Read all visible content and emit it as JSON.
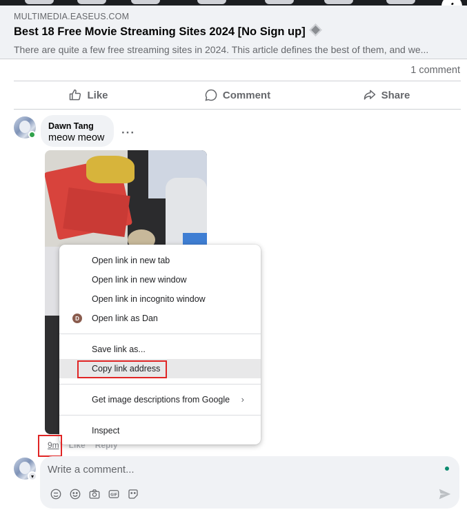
{
  "link_preview": {
    "domain": "MULTIMEDIA.EASEUS.COM",
    "title": "Best 18 Free Movie Streaming Sites 2024 [No Sign up]",
    "description": "There are quite a few free streaming sites in 2024. This article defines the best of them, and we..."
  },
  "post_stats": {
    "comment_count": "1 comment"
  },
  "actions": {
    "like": "Like",
    "comment": "Comment",
    "share": "Share"
  },
  "comment": {
    "author": "Dawn Tang",
    "text": "meow meow",
    "more_options": "···",
    "time": "9m",
    "like_label": "Like",
    "reply_label": "Reply"
  },
  "context_menu": {
    "items": [
      {
        "label": "Open link in new tab"
      },
      {
        "label": "Open link in new window"
      },
      {
        "label": "Open link in incognito window"
      },
      {
        "label": "Open link as Dan",
        "profile_initial": "D"
      }
    ],
    "items2": [
      {
        "label": "Save link as..."
      },
      {
        "label": "Copy link address"
      }
    ],
    "items3": [
      {
        "label": "Get image descriptions from Google",
        "arrow": "›"
      }
    ],
    "items4": [
      {
        "label": "Inspect"
      }
    ]
  },
  "composer": {
    "placeholder": "Write a comment..."
  },
  "colors": {
    "highlight_box": "#e02424",
    "online": "#31a24c",
    "muted_text": "#65676b"
  }
}
